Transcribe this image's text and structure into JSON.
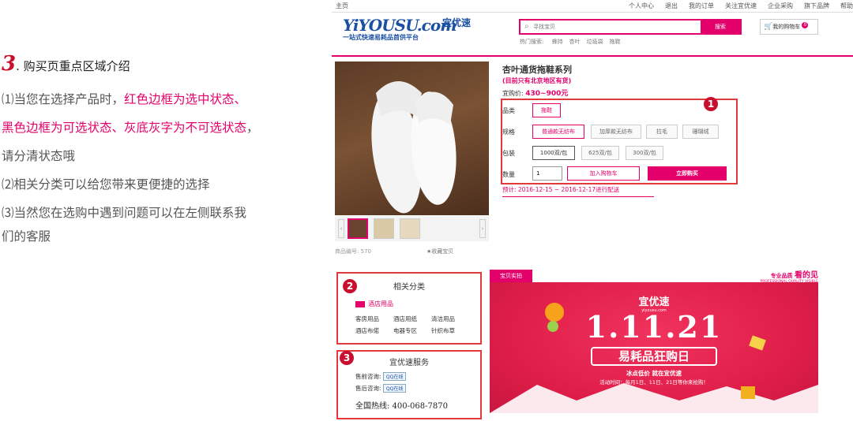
{
  "left": {
    "step_number": "3",
    "heading": ". 购买页重点区域介绍",
    "p1_prefix": "⑴当您在选择产品时，",
    "p1_red1": "红色边框为选中状态、",
    "p1_red2": "黑色边框为可选状态、灰底灰字为不可选状态",
    "p1_tail": "，",
    "p1_line3": "请分清状态哦",
    "p2": "⑵相关分类可以给您带来更便捷的选择",
    "p3_line1": "⑶当然您在选购中遇到问题可以在左侧联系我",
    "p3_line2": "们的客服"
  },
  "header": {
    "home": "主页",
    "nav": [
      "个人中心",
      "退出",
      "我的订单",
      "关注宜优速",
      "企业采购",
      "旗下品牌",
      "帮助"
    ],
    "logo_main": "YiYOUSU.com",
    "logo_cn": "宜优速",
    "logo_slogan": "一站式快速易耗品首供平台",
    "search_placeholder": "寻找宝贝",
    "search_button": "搜索",
    "hot_label": "热门搜索:",
    "hot_items": [
      "蜂持",
      "杏叶",
      "垃圾袋",
      "拖鞋"
    ],
    "cart_label": "我的购物车",
    "cart_count": "0"
  },
  "product": {
    "title": "杏叶通货拖鞋系列",
    "subtitle": "(目前只有北京地区有货)",
    "price_label": "宜购价:",
    "price": "430~900元",
    "product_code_label": "商品编号:",
    "product_code": "570",
    "favorite": "收藏宝贝",
    "rows": {
      "category_label": "品类",
      "category_value": "拖鞋",
      "spec_label": "规格",
      "spec_options": [
        "普通款无纺布",
        "加厚款无纺布",
        "拉毛",
        "珊瑚绒"
      ],
      "pack_label": "包装",
      "pack_options": [
        "1000双/包",
        "625双/包",
        "300双/包"
      ],
      "qty_label": "数量",
      "qty_value": "1",
      "add_cart": "加入购物车",
      "buy_now": "立即购买"
    },
    "delivery": "预计: 2016-12-15 ~ 2016-12-17进行配送"
  },
  "related": {
    "title": "相关分类",
    "main_cat": "酒店用品",
    "items": [
      "客房用品",
      "酒店用纸",
      "清洁用品",
      "酒店布偌",
      "电器专区",
      "针织布草"
    ]
  },
  "service": {
    "title": "宜优速服务",
    "pre_label": "售前咨询:",
    "post_label": "售后咨询:",
    "qq": "QQ在线",
    "hotline": "全国热线: 400-068-7870"
  },
  "banner": {
    "tab": "宝贝实拍",
    "right_top": "专业品质",
    "right_top2": "看的见",
    "right_sub": "PROFESSIONAL QUALITY VISIBLE",
    "brand": "宜优速",
    "brand_url": "yiyousu.com",
    "big": "1.11.21",
    "headline": "易耗品狂购日",
    "sub1": "冰点低价  就在宜优速",
    "sub2": "活动时间：每月1日、11日、21日等你来抢购！"
  },
  "badges": [
    "1",
    "2",
    "3"
  ],
  "colors": {
    "accent": "#e4006b",
    "frame": "#e23a3a",
    "banner": "#e8204e"
  }
}
